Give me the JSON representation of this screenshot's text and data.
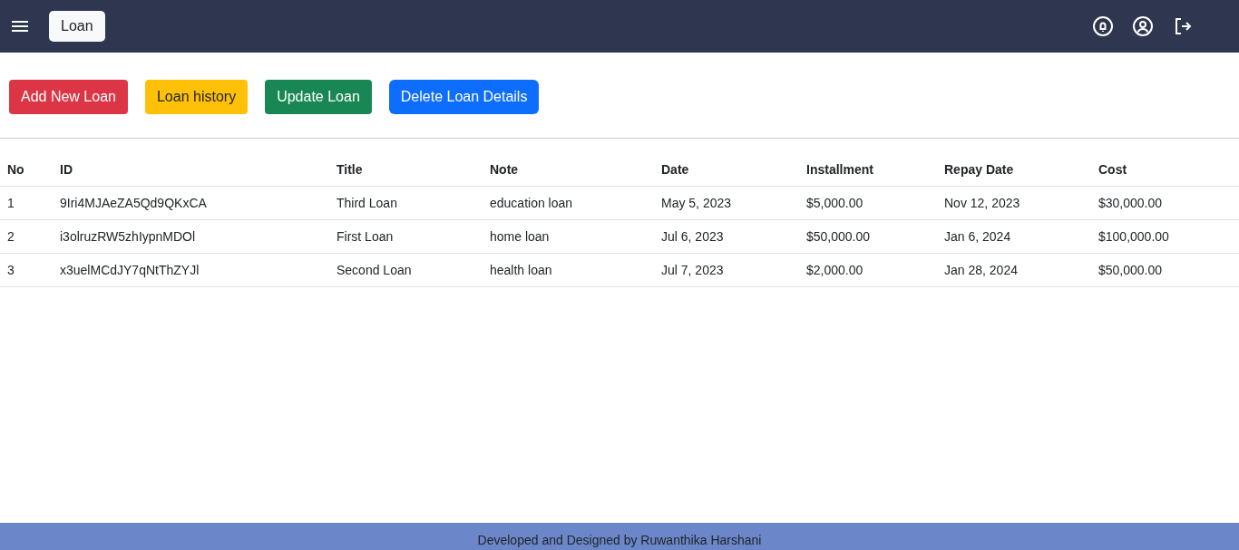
{
  "navbar": {
    "brand": "Loan"
  },
  "actions": [
    {
      "label": "Add New Loan",
      "kind": "danger"
    },
    {
      "label": "Loan history",
      "kind": "warning"
    },
    {
      "label": "Update Loan",
      "kind": "success"
    },
    {
      "label": "Delete Loan Details",
      "kind": "primary"
    }
  ],
  "table": {
    "columns": [
      "No",
      "ID",
      "Title",
      "Note",
      "Date",
      "Installment",
      "Repay Date",
      "Cost"
    ],
    "rows": [
      [
        "1",
        "9Iri4MJAeZA5Qd9QKxCA",
        "Third Loan",
        "education loan",
        "May 5, 2023",
        "$5,000.00",
        "Nov 12, 2023",
        "$30,000.00"
      ],
      [
        "2",
        "i3olruzRW5zhIypnMDOl",
        "First Loan",
        "home loan",
        "Jul 6, 2023",
        "$50,000.00",
        "Jan 6, 2024",
        "$100,000.00"
      ],
      [
        "3",
        "x3uelMCdJY7qNtThZYJl",
        "Second Loan",
        "health loan",
        "Jul 7, 2023",
        "$2,000.00",
        "Jan 28, 2024",
        "$50,000.00"
      ]
    ]
  },
  "footer": {
    "text": "Developed and Designed by Ruwanthika Harshani"
  }
}
